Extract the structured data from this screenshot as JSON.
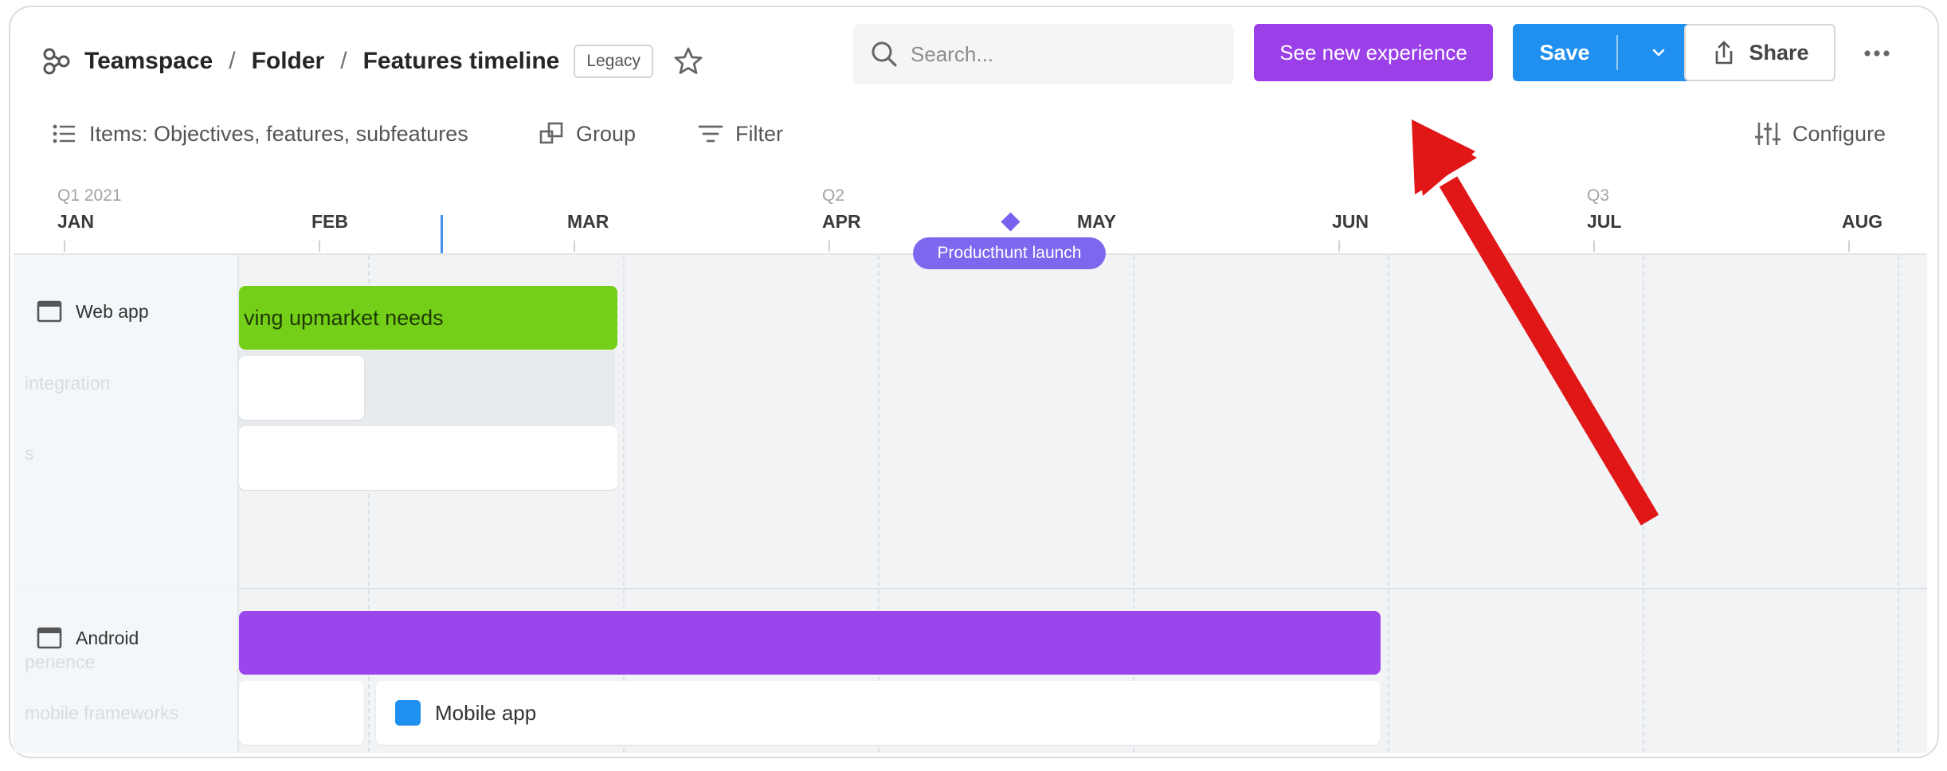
{
  "breadcrumb": {
    "items": [
      "Teamspace",
      "Folder",
      "Features timeline"
    ],
    "separator": "/",
    "badge": "Legacy"
  },
  "search": {
    "placeholder": "Search..."
  },
  "buttons": {
    "new_experience": "See new experience",
    "save": "Save",
    "share": "Share"
  },
  "toolbar": {
    "items_label": "Items: Objectives, features, subfeatures",
    "group_label": "Group",
    "filter_label": "Filter",
    "configure_label": "Configure"
  },
  "timeline": {
    "quarters": [
      "Q1 2021",
      "Q2",
      "Q3"
    ],
    "months": [
      "JAN",
      "FEB",
      "MAR",
      "APR",
      "MAY",
      "JUN",
      "JUL",
      "AUG"
    ],
    "milestone": "Producthunt launch"
  },
  "groups": [
    {
      "name": "Web app",
      "bar_label": "ving upmarket needs",
      "ghost_labels": [
        "integration",
        "s"
      ]
    },
    {
      "name": "Android",
      "ghost_labels": [
        "perience",
        "mobile frameworks"
      ],
      "card_label": "Mobile app"
    }
  ],
  "colors": {
    "new_experience": "#9b3fe8",
    "save": "#1f8ff0",
    "green_bar": "#74cf18",
    "purple_bar": "#9b45ed",
    "milestone": "#7f66ee",
    "arrow": "#e11616"
  }
}
